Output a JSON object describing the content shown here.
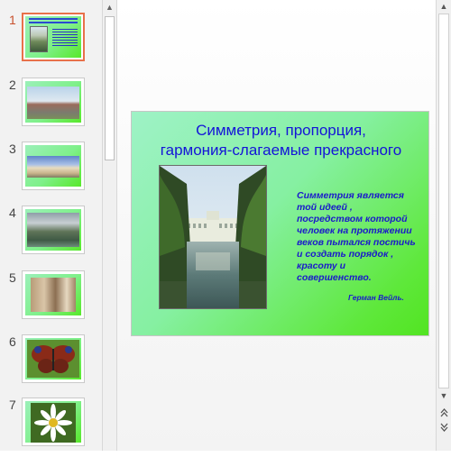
{
  "thumbnails": [
    {
      "number": "1",
      "theme": "title-slide"
    },
    {
      "number": "2",
      "theme": "kremlin"
    },
    {
      "number": "3",
      "theme": "palace"
    },
    {
      "number": "4",
      "theme": "fountains"
    },
    {
      "number": "5",
      "theme": "classroom"
    },
    {
      "number": "6",
      "theme": "butterfly"
    },
    {
      "number": "7",
      "theme": "daisy"
    }
  ],
  "selected_slide": "1",
  "slide": {
    "title_line1": "Симметрия, пропорция,",
    "title_line2": "гармония-слагаемые прекрасного",
    "quote": "Симметрия является той идеей , посредством которой человек на протяжении веков пытался постичь и создать порядок , красоту и совершенство.",
    "author": "Герман Вейль."
  },
  "icons": {
    "scroll_up": "scroll-up-icon",
    "scroll_down": "scroll-down-icon",
    "prev_slide": "previous-slide-icon",
    "next_slide": "next-slide-icon"
  },
  "colors": {
    "title_text": "#1414d8",
    "quote_text": "#1a1acb",
    "selection": "#e8714a",
    "slide_bg_start": "#9ef2c6",
    "slide_bg_end": "#52e422"
  }
}
